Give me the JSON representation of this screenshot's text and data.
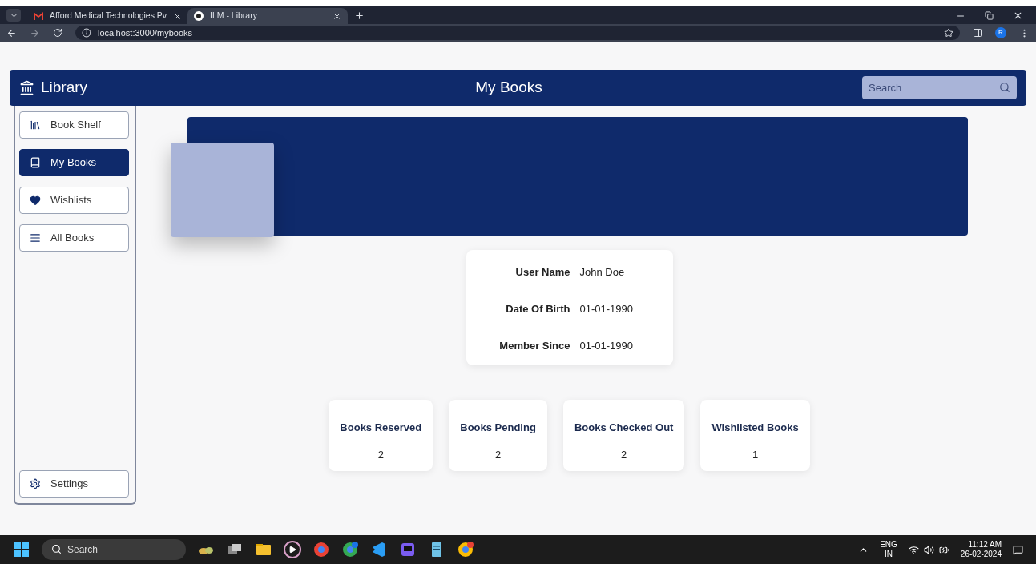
{
  "browser": {
    "tabs": [
      {
        "title": "Afford Medical Technologies Pv",
        "selected": false,
        "kind": "mail"
      },
      {
        "title": "ILM - Library",
        "selected": true,
        "kind": "app"
      }
    ],
    "url": "localhost:3000/mybooks",
    "profile_initial": "R"
  },
  "header": {
    "brand": "Library",
    "title": "My Books",
    "search": {
      "placeholder": "Search"
    }
  },
  "sidebar": {
    "items": [
      {
        "label": "Book Shelf",
        "kind": "shelf",
        "selected": false
      },
      {
        "label": "My Books",
        "kind": "book",
        "selected": true
      },
      {
        "label": "Wishlists",
        "kind": "heart",
        "selected": false
      },
      {
        "label": "All Books",
        "kind": "list",
        "selected": false
      }
    ],
    "footer": {
      "label": "Settings",
      "kind": "settings",
      "selected": false
    }
  },
  "profile": {
    "rows": [
      {
        "label": "User Name",
        "value": "John Doe"
      },
      {
        "label": "Date Of Birth",
        "value": "01-01-1990"
      },
      {
        "label": "Member Since",
        "value": "01-01-1990"
      }
    ]
  },
  "stats": [
    {
      "label": "Books Reserved",
      "value": "2"
    },
    {
      "label": "Books Pending",
      "value": "2"
    },
    {
      "label": "Books Checked Out",
      "value": "2"
    },
    {
      "label": "Wishlisted Books",
      "value": "1"
    }
  ],
  "taskbar": {
    "search": {
      "placeholder": "Search"
    },
    "language": "ENG",
    "region": "IN",
    "time": "11:12 AM",
    "date": "26-02-2024"
  }
}
